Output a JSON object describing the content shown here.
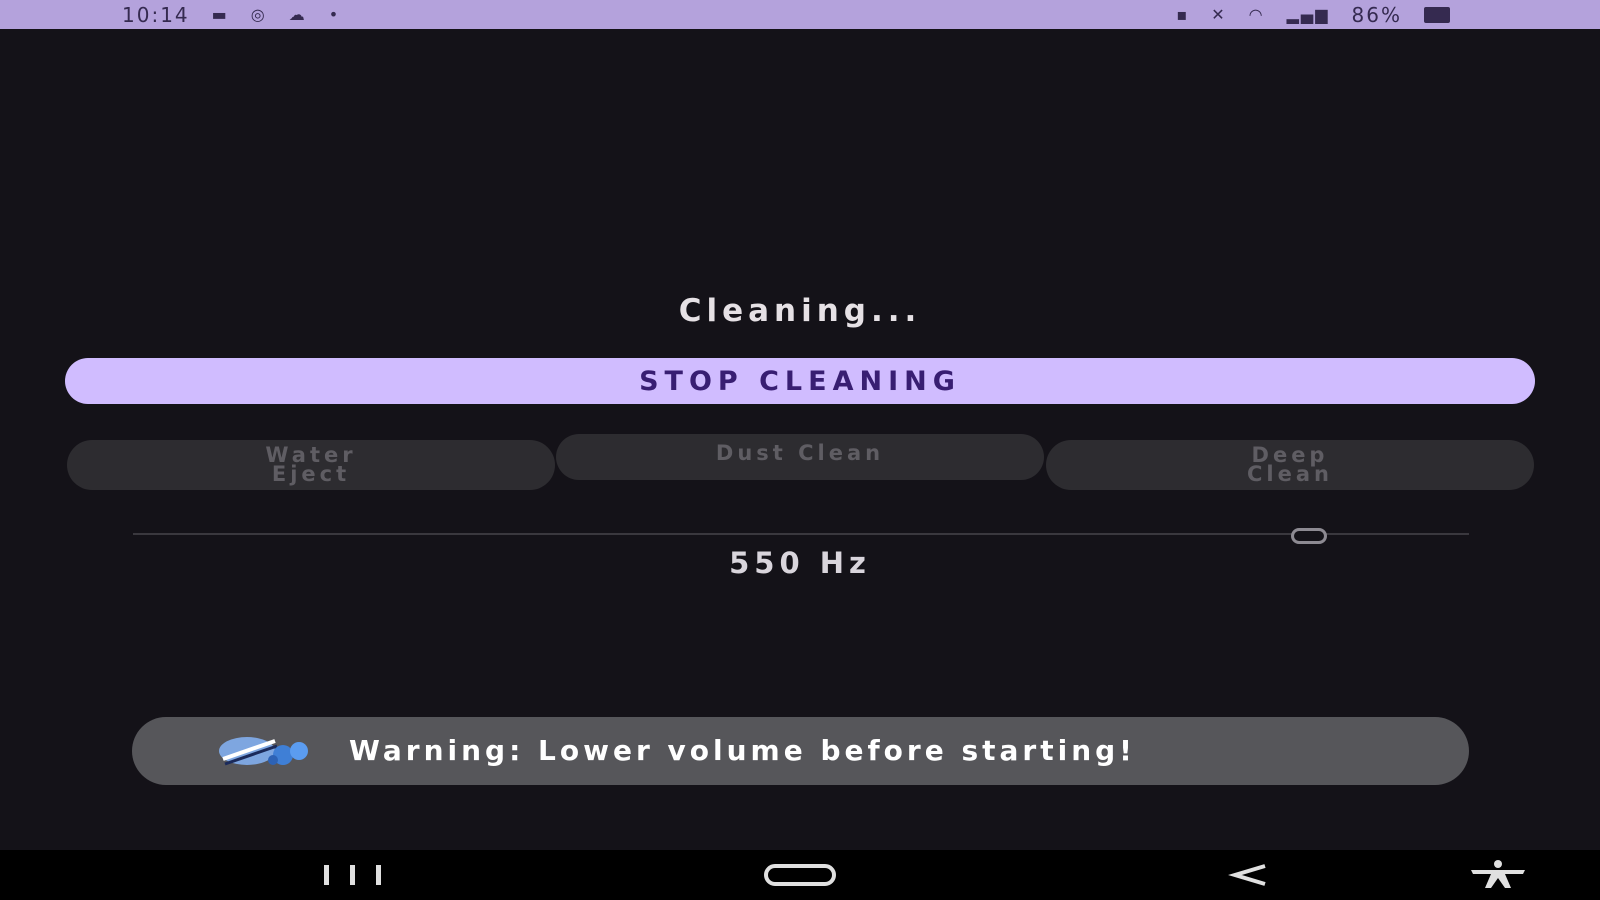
{
  "status_bar": {
    "time": "10:14",
    "left_icons": [
      "gallery-icon",
      "at-sign-icon",
      "cloud-icon",
      "dot-icon"
    ],
    "right_icons": [
      "alarm-icon",
      "mute-icon",
      "wifi-icon",
      "signal-icon",
      "battery-icon"
    ],
    "battery": "86%",
    "color": "#d0bcff"
  },
  "main": {
    "status_text": "Cleaning...",
    "stop_label": "STOP CLEANING",
    "modes": [
      {
        "label": "Water\nEject"
      },
      {
        "label": "Dust Clean"
      },
      {
        "label": "Deep\nClean"
      }
    ],
    "frequency": {
      "label": "550 Hz",
      "slider_fraction": 0.88
    }
  },
  "warning": {
    "icon": "water-drops-icon",
    "text": "Warning: Lower volume before starting!"
  },
  "nav": {
    "icons": [
      "recents-icon",
      "home-icon",
      "back-icon",
      "accessibility-icon"
    ]
  },
  "colors": {
    "accent": "#d0bcff",
    "background": "#141218",
    "button_disabled": "#2d2c30",
    "warning_bg": "#56565a"
  }
}
